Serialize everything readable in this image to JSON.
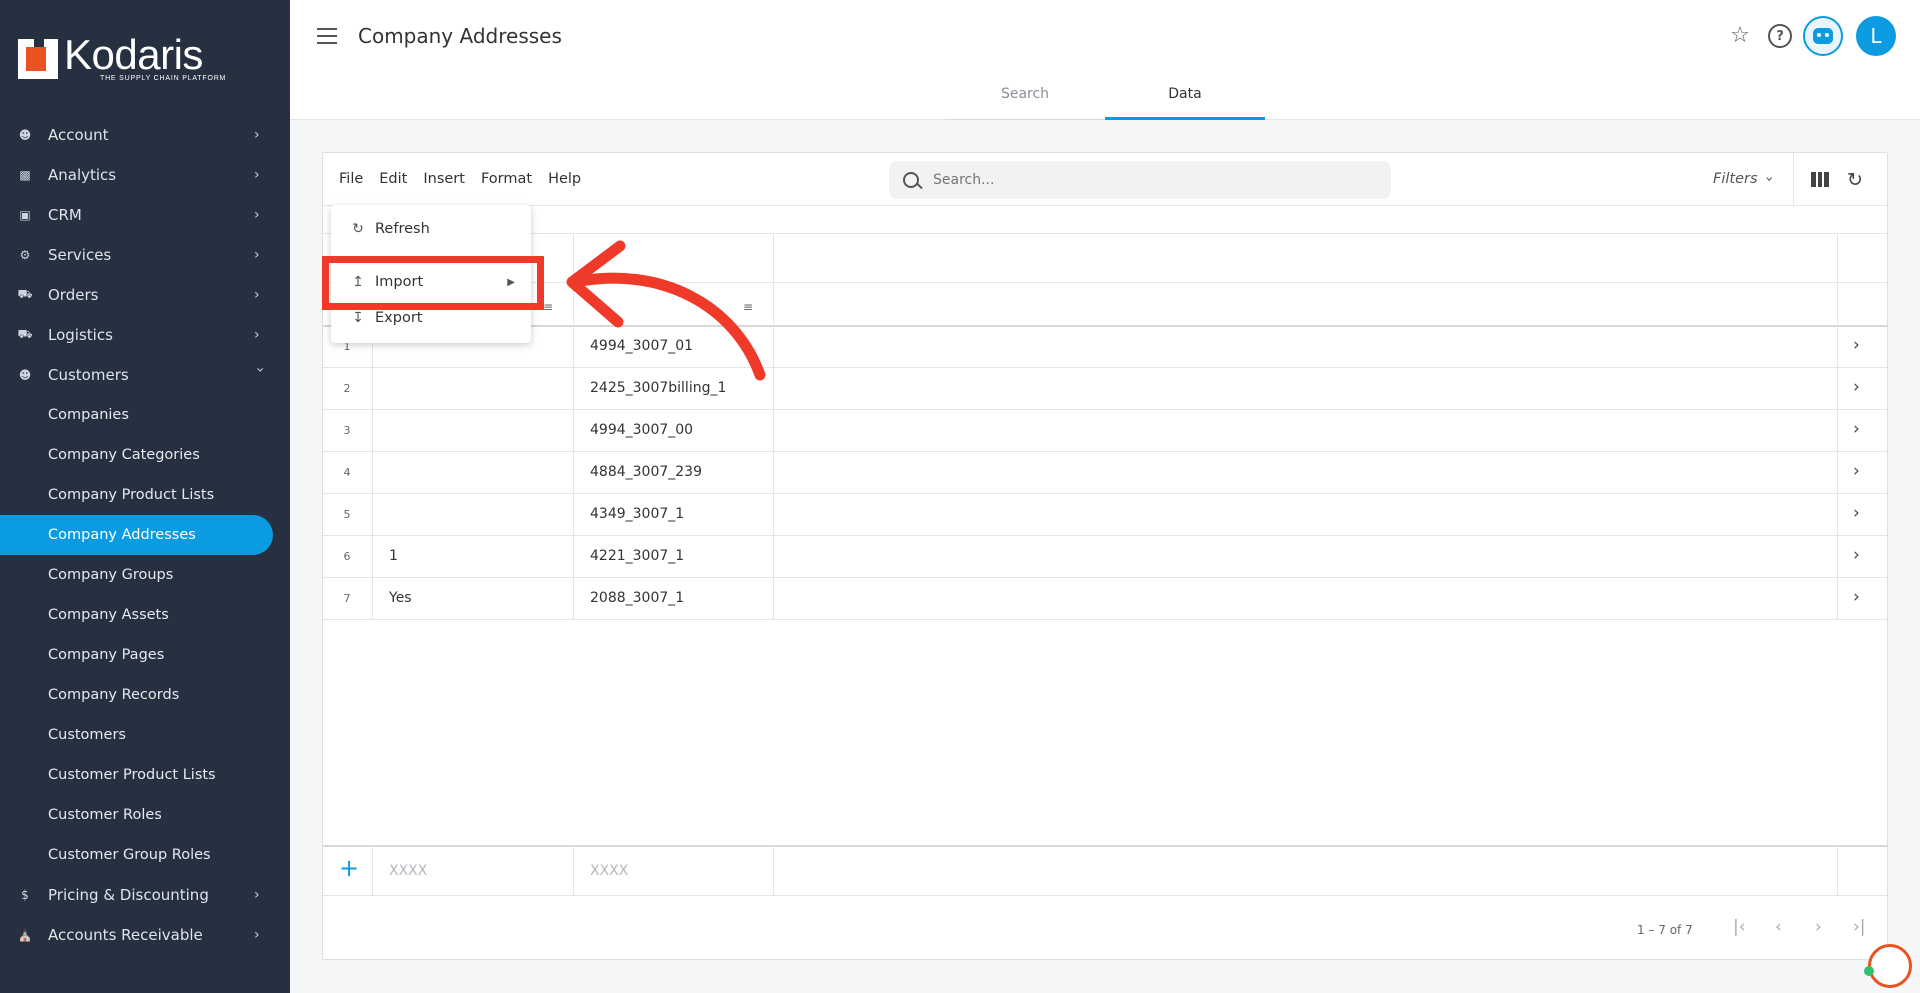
{
  "logo": {
    "name": "Kodaris",
    "tagline": "THE SUPPLY CHAIN PLATFORM"
  },
  "sidebar": {
    "items": [
      {
        "label": "Account",
        "icon": "person-icon"
      },
      {
        "label": "Analytics",
        "icon": "analytics-icon"
      },
      {
        "label": "CRM",
        "icon": "crm-icon"
      },
      {
        "label": "Services",
        "icon": "gears-icon"
      },
      {
        "label": "Orders",
        "icon": "truck-icon"
      },
      {
        "label": "Logistics",
        "icon": "logistics-icon"
      },
      {
        "label": "Customers",
        "icon": "people-icon"
      }
    ],
    "customers_sub": [
      "Companies",
      "Company Categories",
      "Company Product Lists",
      "Company Addresses",
      "Company Groups",
      "Company Assets",
      "Company Pages",
      "Company Records",
      "Customers",
      "Customer Product Lists",
      "Customer Roles",
      "Customer Group Roles"
    ],
    "bottom_items": [
      {
        "label": "Pricing & Discounting",
        "icon": "dollar-icon"
      },
      {
        "label": "Accounts Receivable",
        "icon": "bank-icon"
      }
    ],
    "active": "Company Addresses"
  },
  "header": {
    "title": "Company Addresses",
    "avatar_letter": "L"
  },
  "tabs": [
    {
      "label": "Search"
    },
    {
      "label": "Data"
    }
  ],
  "toolbar": {
    "menu": [
      "File",
      "Edit",
      "Insert",
      "Format",
      "Help"
    ],
    "search_placeholder": "Search...",
    "filters_label": "Filters"
  },
  "dropdown": {
    "items": [
      "Refresh",
      "Import",
      "Export"
    ]
  },
  "table": {
    "rows": [
      {
        "num": "1",
        "col1": "",
        "code": "4994_3007_01"
      },
      {
        "num": "2",
        "col1": "",
        "code": "2425_3007billing_1"
      },
      {
        "num": "3",
        "col1": "",
        "code": "4994_3007_00"
      },
      {
        "num": "4",
        "col1": "",
        "code": "4884_3007_239"
      },
      {
        "num": "5",
        "col1": "",
        "code": "4349_3007_1"
      },
      {
        "num": "6",
        "col1": "1",
        "code": "4221_3007_1"
      },
      {
        "num": "7",
        "col1": "Yes",
        "code": "2088_3007_1"
      }
    ],
    "new_row_placeholder_1": "XXXX",
    "new_row_placeholder_2": "XXXX",
    "pagination": "1 – 7 of 7"
  },
  "colors": {
    "accent": "#0a9be0",
    "sidebar_bg": "#263040",
    "highlight": "#ef3a2a"
  }
}
